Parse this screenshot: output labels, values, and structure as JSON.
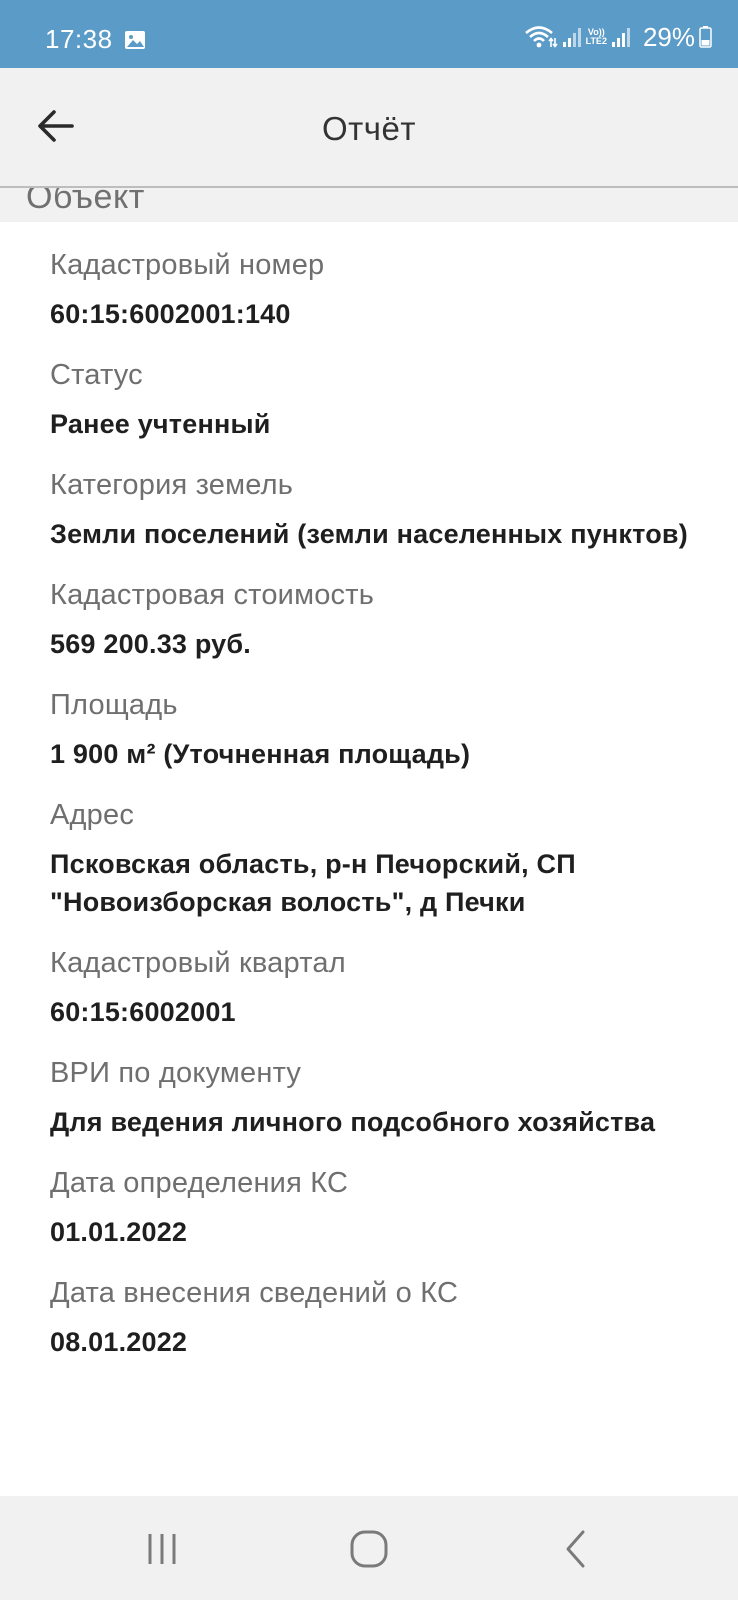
{
  "status_bar": {
    "time": "17:38",
    "lte_line1": "Vo))",
    "lte_line2": "LTE2",
    "battery": "29%"
  },
  "app_bar": {
    "title": "Отчёт",
    "back_icon": "arrow-left-icon"
  },
  "section": {
    "title": "Объект"
  },
  "fields": [
    {
      "label": "Кадастровый номер",
      "value": "60:15:6002001:140"
    },
    {
      "label": "Статус",
      "value": "Ранее учтенный"
    },
    {
      "label": "Категория земель",
      "value": "Земли поселений (земли населенных пунктов)"
    },
    {
      "label": "Кадастровая стоимость",
      "value": "569 200.33 руб."
    },
    {
      "label": "Площадь",
      "value": "1 900 м² (Уточненная площадь)"
    },
    {
      "label": "Адрес",
      "value": "Псковская область, р-н Печорский, СП \"Новоизборская волость\", д Печки"
    },
    {
      "label": "Кадастровый квартал",
      "value": "60:15:6002001"
    },
    {
      "label": "ВРИ по документу",
      "value": "Для ведения личного подсобного хозяйства"
    },
    {
      "label": "Дата определения КС",
      "value": "01.01.2022"
    },
    {
      "label": "Дата внесения сведений о КС",
      "value": "08.01.2022"
    }
  ],
  "nav_bar": {
    "recents_icon": "recents-icon",
    "home_icon": "home-icon",
    "back_icon": "back-chevron-icon"
  }
}
